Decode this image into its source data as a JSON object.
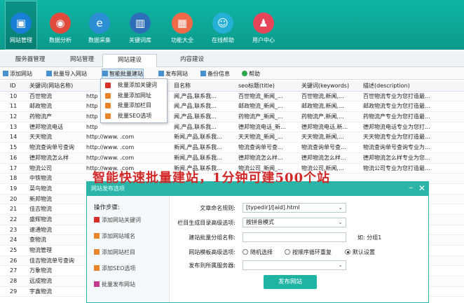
{
  "topbar": {
    "items": [
      {
        "label": "网站管理",
        "icon": "monitor-icon",
        "color": "#1a7fd6"
      },
      {
        "label": "数据分析",
        "icon": "database-icon",
        "color": "#e24b3b"
      },
      {
        "label": "数据采集",
        "icon": "edge-icon",
        "color": "#2c8fd6"
      },
      {
        "label": "关键词库",
        "icon": "book-icon",
        "color": "#2c6fb8"
      },
      {
        "label": "功能大全",
        "icon": "grid-icon",
        "color": "#f06a4a"
      },
      {
        "label": "在线帮助",
        "icon": "help-icon",
        "color": "#25b0d8"
      },
      {
        "label": "用户中心",
        "icon": "user-icon",
        "color": "#e8455a"
      }
    ]
  },
  "tabs": [
    "服务器管理",
    "网站管理",
    "网站建设",
    "内容建设"
  ],
  "toolbar": {
    "add_site": "添加网站",
    "batch_import": "批量导入网站",
    "smart_batch": "智能批量建站",
    "publish_site": "发布网站",
    "backup": "备份信息",
    "help": "帮助"
  },
  "dropdown": {
    "items": [
      {
        "label": "批量添加关键词",
        "color": "#d8302a"
      },
      {
        "label": "批量添加网址",
        "color": "#e8852a"
      },
      {
        "label": "批量添加栏目",
        "color": "#e8852a"
      },
      {
        "label": "批量SEO选项",
        "color": "#e8852a"
      }
    ]
  },
  "grid": {
    "headers": {
      "id": "ID",
      "kw": "关键词(网站名称)",
      "url": "",
      "col": "目名称",
      "seo": "seo标题(title)",
      "kws": "关键词(keywords)",
      "desc": "描述(description)"
    },
    "rows": [
      {
        "id": "10",
        "kw": "百世物流",
        "url": "http",
        "col": "闻,产品,联系我...",
        "seo": "百世物流_新闻_...",
        "kws": "百世物流,新闻,...",
        "desc": "百世物流专业为您打造最..."
      },
      {
        "id": "11",
        "kw": "邮政物流",
        "url": "http",
        "col": "闻,产品,联系我...",
        "seo": "邮政物流_新闻_...",
        "kws": "邮政物流,新闻,...",
        "desc": "邮政物流专业为您打造最..."
      },
      {
        "id": "12",
        "kw": "药物流产",
        "url": "http",
        "col": "闻,产品,联系我...",
        "seo": "药物流产_新闻_...",
        "kws": "药物流产,新闻,...",
        "desc": "药物流产专业为您打造最..."
      },
      {
        "id": "13",
        "kw": "德邦物流电话",
        "url": "http",
        "col": "闻,产品,联系我...",
        "seo": "德邦物流电话_新...",
        "kws": "德邦物流电话,新...",
        "desc": "德邦物流电话专业为您打..."
      },
      {
        "id": "14",
        "kw": "天天物流",
        "url": "http://www.      .com",
        "col": "新闻,产品,联系我...",
        "seo": "天天物流_新闻_...",
        "kws": "天天物流,新闻,...",
        "desc": "天天物流专业为您打造最..."
      },
      {
        "id": "15",
        "kw": "物流查询单号查询",
        "url": "http://www.      .com",
        "col": "新闻,产品,联系我...",
        "seo": "物流查询单号查...",
        "kws": "物流查询单号查...",
        "desc": "物流查询单号查询专业为..."
      },
      {
        "id": "16",
        "kw": "德邦物流怎么样",
        "url": "http://www.      .com",
        "col": "新闻,产品,联系我...",
        "seo": "德邦物流怎么样...",
        "kws": "德邦物流怎么样...",
        "desc": "德邦物流怎么样专业为您..."
      },
      {
        "id": "17",
        "kw": "物流公司",
        "url": "http://www.      .com",
        "col": "新闻,产品,联系我...",
        "seo": "物流公司_新闻_...",
        "kws": "物流公司,新闻,...",
        "desc": "物流公司专业为您打造最..."
      },
      {
        "id": "18",
        "kw": "中铁物流",
        "url": "",
        "col": "",
        "seo": "",
        "kws": "",
        "desc": ""
      },
      {
        "id": "19",
        "kw": "菜鸟物流",
        "url": "",
        "col": "",
        "seo": "",
        "kws": "",
        "desc": ""
      },
      {
        "id": "20",
        "kw": "新邦物流",
        "url": "",
        "col": "",
        "seo": "",
        "kws": "",
        "desc": ""
      },
      {
        "id": "21",
        "kw": "佳吉物流",
        "url": "",
        "col": "",
        "seo": "",
        "kws": "",
        "desc": ""
      },
      {
        "id": "22",
        "kw": "盛辉物流",
        "url": "",
        "col": "",
        "seo": "",
        "kws": "",
        "desc": ""
      },
      {
        "id": "23",
        "kw": "速通物流",
        "url": "",
        "col": "",
        "seo": "",
        "kws": "",
        "desc": ""
      },
      {
        "id": "24",
        "kw": "查物流",
        "url": "",
        "col": "",
        "seo": "",
        "kws": "",
        "desc": ""
      },
      {
        "id": "25",
        "kw": "物流管理",
        "url": "",
        "col": "",
        "seo": "",
        "kws": "",
        "desc": ""
      },
      {
        "id": "26",
        "kw": "佳吉物流单号查询",
        "url": "",
        "col": "",
        "seo": "",
        "kws": "",
        "desc": ""
      },
      {
        "id": "27",
        "kw": "万象物流",
        "url": "",
        "col": "",
        "seo": "",
        "kws": "",
        "desc": ""
      },
      {
        "id": "28",
        "kw": "远成物流",
        "url": "",
        "col": "",
        "seo": "",
        "kws": "",
        "desc": ""
      },
      {
        "id": "29",
        "kw": "宇鑫物流",
        "url": "",
        "col": "",
        "seo": "",
        "kws": "",
        "desc": ""
      }
    ]
  },
  "banner": "智能快速批量建站，1分钟可建500个站",
  "dialog": {
    "title": "网站发布选项",
    "steps_title": "操作步骤:",
    "steps": [
      {
        "label": "添加网站关键词",
        "color": "#d8302a"
      },
      {
        "label": "添加网站域名",
        "color": "#e8852a"
      },
      {
        "label": "添加网站栏目",
        "color": "#e8852a"
      },
      {
        "label": "添加SEO选项",
        "color": "#e8852a"
      },
      {
        "label": "批量发布网站",
        "color": "#c43a8e"
      }
    ],
    "fields": {
      "naming_label": "文章命名规则:",
      "naming_value": "[typedir]/[aid].html",
      "column_label": "栏目生成目录高级选项:",
      "column_value": "按拼音模式",
      "group_label": "建站批量分组名称:",
      "group_value": "",
      "group_hint": "如: 分组1",
      "template_label": "网站模板高级选项:",
      "radio_random": "随机选择",
      "radio_sequential": "按顺序循环重复",
      "radio_default": "默认设置",
      "server_label": "发布到所属服务器:",
      "server_value": ""
    },
    "publish_button": "发布网站"
  }
}
